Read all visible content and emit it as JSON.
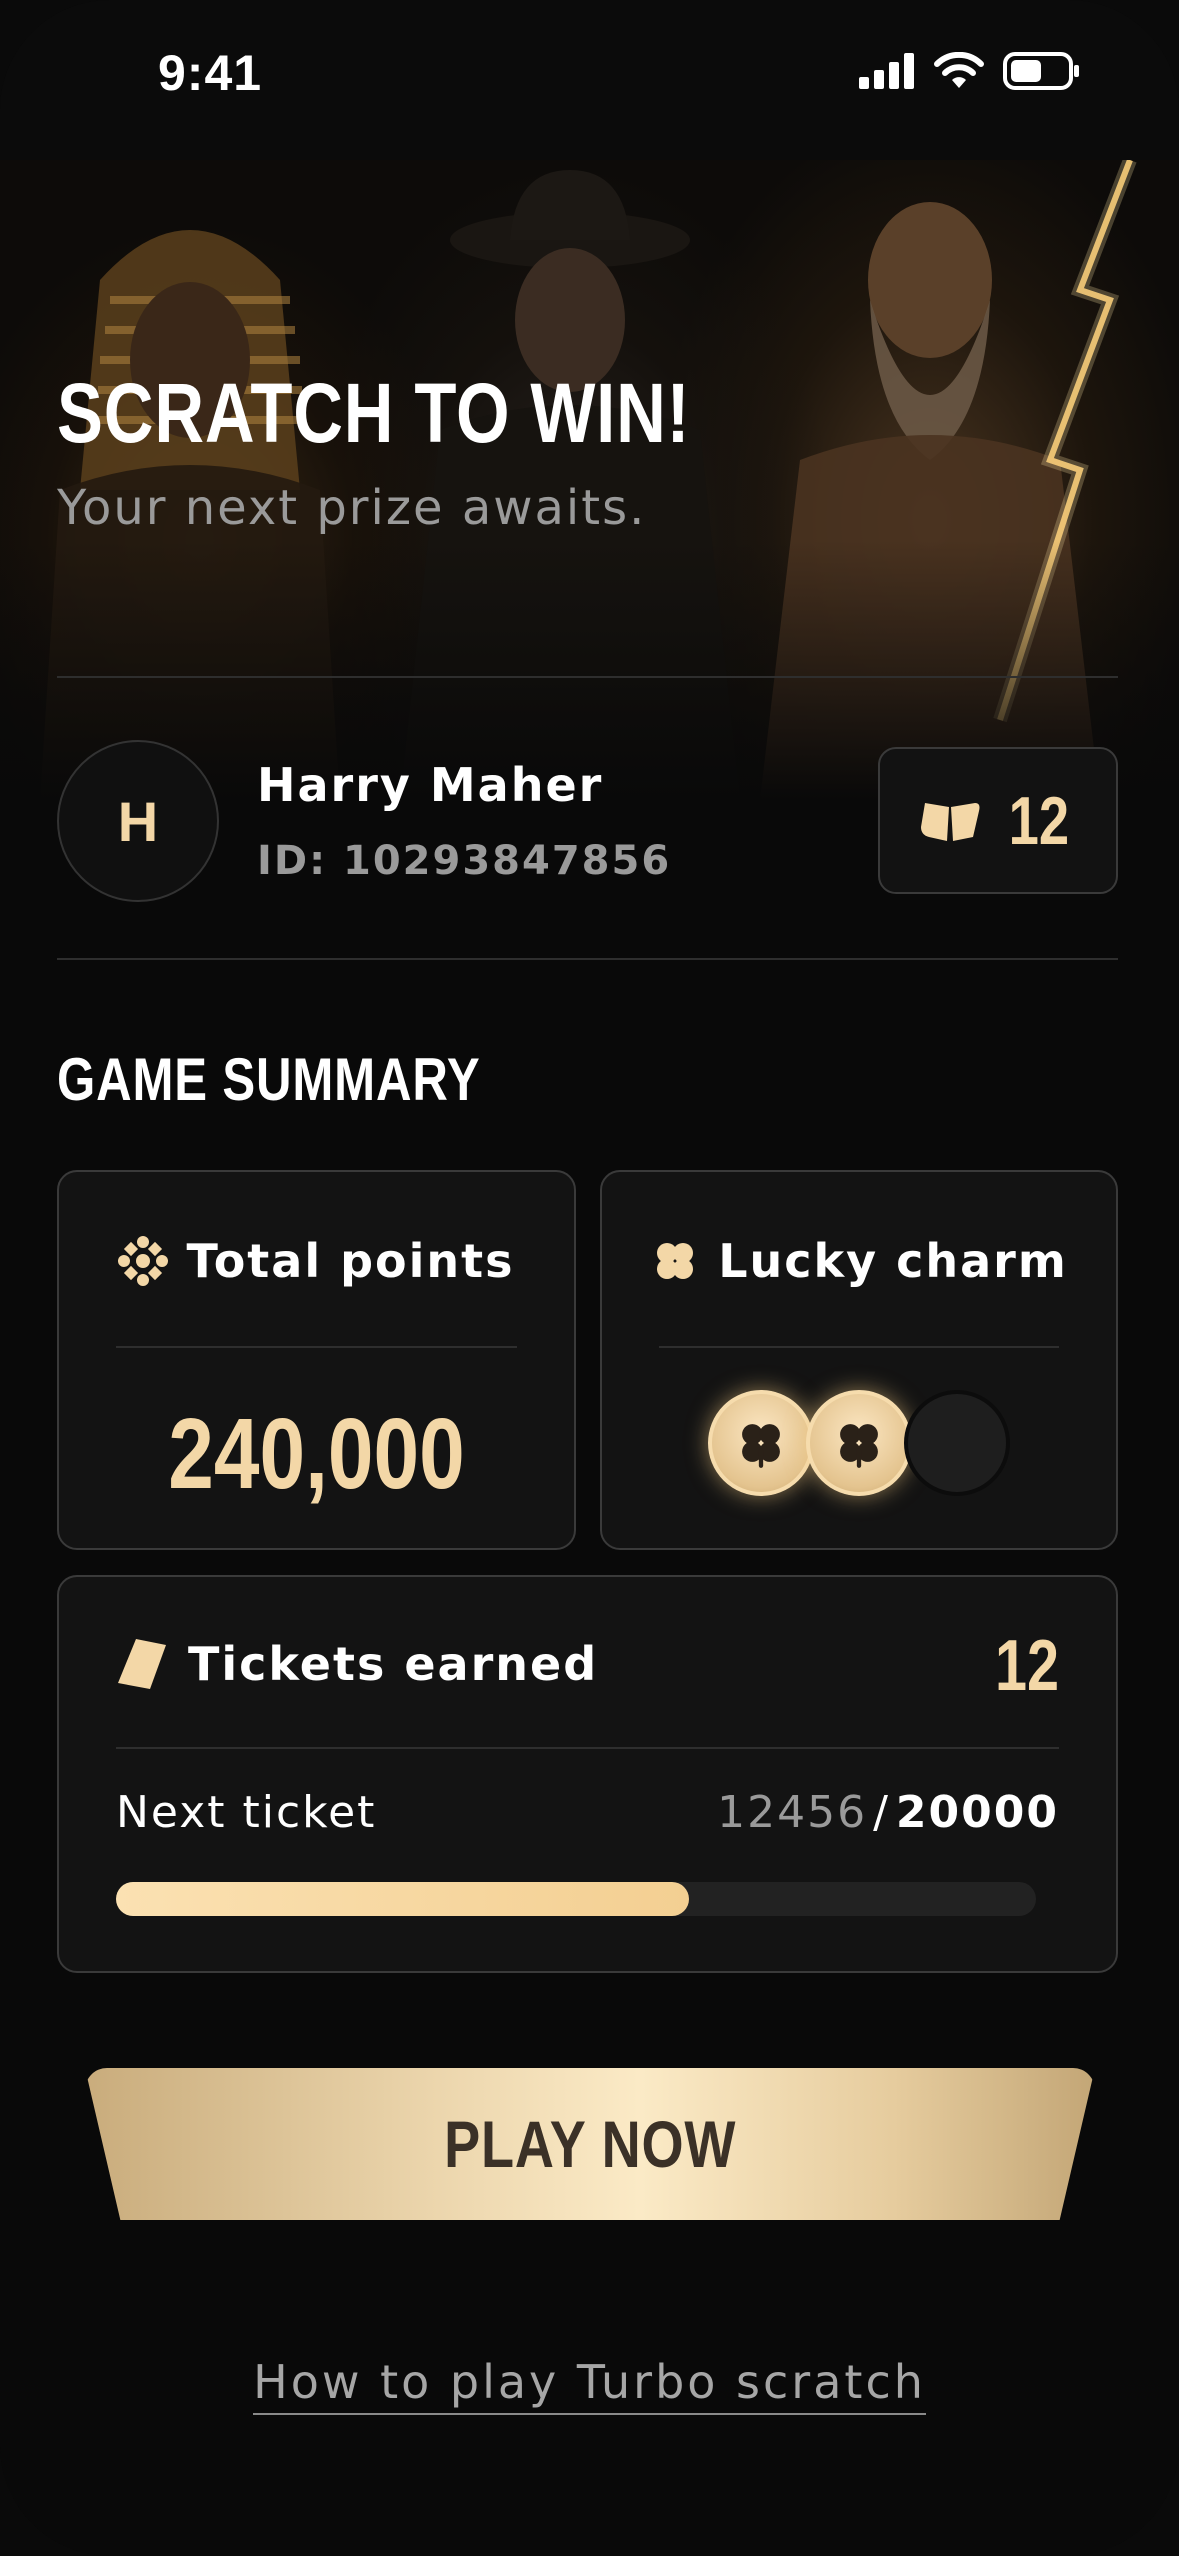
{
  "status_bar": {
    "time": "9:41"
  },
  "hero": {
    "title": "SCRATCH TO WIN!",
    "subtitle": "Your next prize awaits."
  },
  "profile": {
    "avatar_initial": "H",
    "name": "Harry Maher",
    "id_text": "ID: 10293847856",
    "ticket_count": "12"
  },
  "summary": {
    "title": "GAME SUMMARY",
    "total_points": {
      "label": "Total points",
      "value": "240,000"
    },
    "lucky_charm": {
      "label": "Lucky charm",
      "active": 2,
      "total": 3
    },
    "tickets": {
      "label": "Tickets earned",
      "value": "12",
      "next_label": "Next ticket",
      "current": "12456",
      "separator": "/",
      "target": "20000",
      "progress": 0.6228
    }
  },
  "actions": {
    "play_label": "PLAY NOW",
    "how_to_play": "How to play Turbo scratch"
  },
  "colors": {
    "accent": "#f3d7a7",
    "background": "#090909",
    "card": "#131313"
  }
}
